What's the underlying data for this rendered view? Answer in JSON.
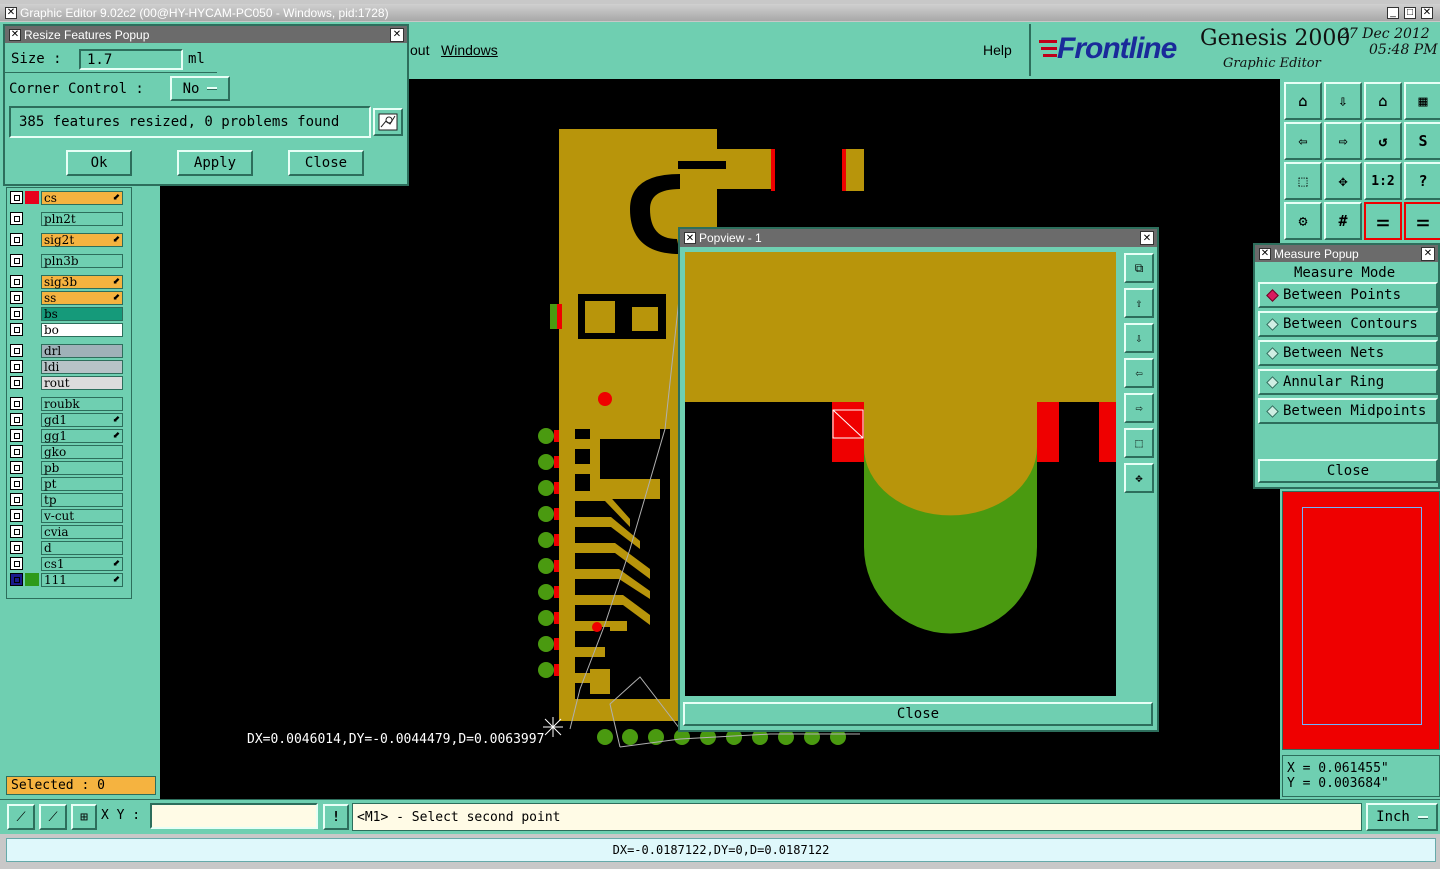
{
  "window": {
    "title": "Graphic Editor 9.02c2 (00@HY-HYCAM-PC050 - Windows, pid:1728)"
  },
  "menu": {
    "items": [
      "out",
      "Windows"
    ],
    "help": "Help"
  },
  "brand": {
    "logo": "Frontline",
    "product": "Genesis 2000",
    "subtitle": "Graphic Editor",
    "date": "27 Dec 2012",
    "time": "05:48 PM"
  },
  "resize_popup": {
    "title": "Resize Features Popup",
    "size_label": "Size :",
    "size_value": "1.7",
    "size_unit": "ml",
    "corner_label": "Corner Control :",
    "corner_value": "No",
    "status": "385 features resized, 0 problems found",
    "ok": "Ok",
    "apply": "Apply",
    "close": "Close"
  },
  "layers": [
    {
      "name": "cs",
      "color": "#e8001c",
      "bg": "#f5b340",
      "affected": true
    },
    {
      "name": "pln2t",
      "color": "",
      "bg": "#6fcfb1",
      "affected": false
    },
    {
      "name": "sig2t",
      "color": "",
      "bg": "#f5b340",
      "affected": true
    },
    {
      "name": "pln3b",
      "color": "",
      "bg": "#6fcfb1",
      "affected": false
    },
    {
      "name": "sig3b",
      "color": "",
      "bg": "#f5b340",
      "affected": true
    },
    {
      "name": "ss",
      "color": "",
      "bg": "#f5b340",
      "affected": true
    },
    {
      "name": "bs",
      "color": "",
      "bg": "#159a7a",
      "affected": false
    },
    {
      "name": "bo",
      "color": "",
      "bg": "#ffffff",
      "affected": false
    },
    {
      "name": "drl",
      "color": "",
      "bg": "#9fb1b8",
      "affected": false
    },
    {
      "name": "ldi",
      "color": "",
      "bg": "#b7c3c7",
      "affected": false
    },
    {
      "name": "rout",
      "color": "",
      "bg": "#dcdcdc",
      "affected": false
    },
    {
      "name": "roubk",
      "color": "",
      "bg": "#6fcfb1",
      "affected": false
    },
    {
      "name": "gd1",
      "color": "",
      "bg": "#6fcfb1",
      "affected": true
    },
    {
      "name": "gg1",
      "color": "",
      "bg": "#6fcfb1",
      "affected": true
    },
    {
      "name": "gko",
      "color": "",
      "bg": "#6fcfb1",
      "affected": false
    },
    {
      "name": "pb",
      "color": "",
      "bg": "#6fcfb1",
      "affected": false
    },
    {
      "name": "pt",
      "color": "",
      "bg": "#6fcfb1",
      "affected": false
    },
    {
      "name": "tp",
      "color": "",
      "bg": "#6fcfb1",
      "affected": false
    },
    {
      "name": "v-cut",
      "color": "",
      "bg": "#6fcfb1",
      "affected": false
    },
    {
      "name": "cvia",
      "color": "",
      "bg": "#6fcfb1",
      "affected": false
    },
    {
      "name": "d",
      "color": "",
      "bg": "#6fcfb1",
      "affected": false
    },
    {
      "name": "cs1",
      "color": "",
      "bg": "#6fcfb1",
      "affected": true
    },
    {
      "name": "111",
      "color": "#2e9a1a",
      "bg": "#6fcfb1",
      "affected": true
    }
  ],
  "selected": "Selected : 0",
  "popview": {
    "title": "Popview - 1",
    "close": "Close"
  },
  "measure": {
    "title": "Measure Popup",
    "mode_label": "Measure Mode",
    "options": [
      "Between Points",
      "Between Contours",
      "Between Nets",
      "Annular Ring",
      "Between Midpoints"
    ],
    "selected": "Between Points",
    "close": "Close"
  },
  "coords": {
    "x": "X = 0.061455\"",
    "y": "Y = 0.003684\""
  },
  "canvas_readout": "DX=0.0046014,DY=-0.0044479,D=0.0063997",
  "command": {
    "xy_label": "X Y :",
    "xy_value": "",
    "prompt": "<M1> - Select second point",
    "unit": "Inch"
  },
  "status_bar": "DX=-0.0187122,DY=0,D=0.0187122",
  "colors": {
    "panel": "#6fcfb1",
    "copper": "#b8950b",
    "pad": "#4a9a10",
    "highlight": "#ef0000",
    "canvas": "#000000"
  }
}
